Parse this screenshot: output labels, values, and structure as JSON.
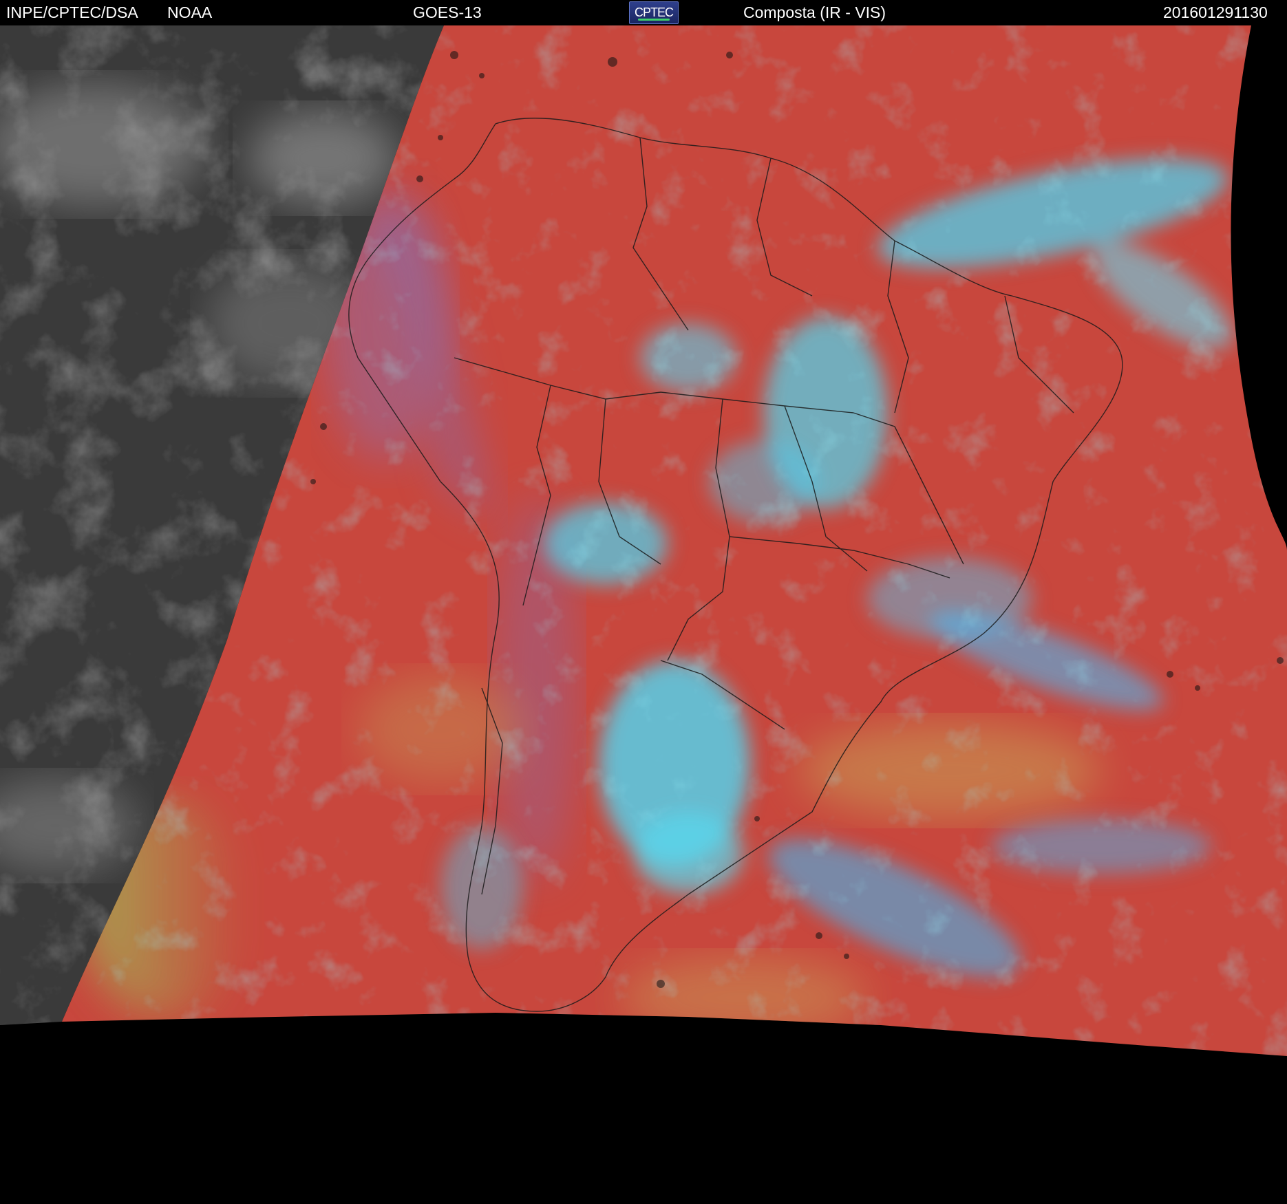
{
  "header": {
    "agency": "INPE/CPTEC/DSA",
    "partner": "NOAA",
    "satellite": "GOES-13",
    "logo_text": "CPTEC",
    "product": "Composta (IR - VIS)",
    "timestamp": "201601291130"
  },
  "colors": {
    "background": "#000000",
    "header_text": "#ffffff",
    "composite_red": "#c8473d",
    "cloud_cyan": "#4fd8f0",
    "night_gray": "#3c3c3c",
    "border_lines": "#1a1a1a"
  }
}
